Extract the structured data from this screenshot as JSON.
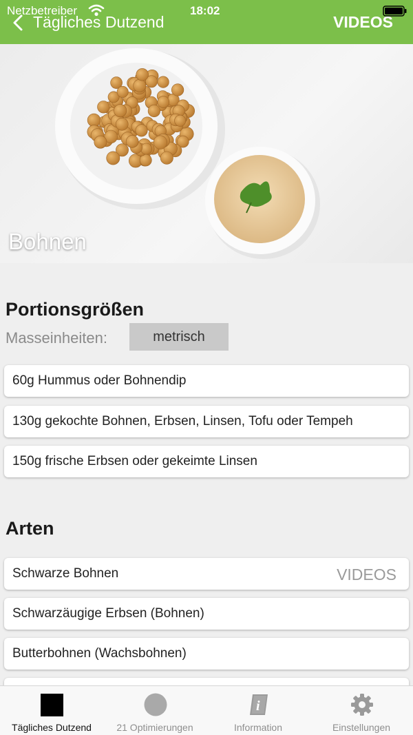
{
  "status_bar": {
    "carrier": "Netzbetreiber",
    "time": "18:02"
  },
  "nav": {
    "back_label": "Tägliches Dutzend",
    "videos_label": "VIDEOS"
  },
  "hero": {
    "title": "Bohnen"
  },
  "portions": {
    "title": "Portionsgrößen",
    "units_label": "Masseinheiten:",
    "units_value": "metrisch",
    "items": [
      "60g Hummus oder Bohnendip",
      "130g gekochte Bohnen, Erbsen, Linsen, Tofu oder Tempeh",
      "150g frische Erbsen oder gekeimte Linsen"
    ]
  },
  "types": {
    "title": "Arten",
    "items": [
      {
        "label": "Schwarze Bohnen",
        "videos": "VIDEOS"
      },
      {
        "label": "Schwarzäugige Erbsen (Bohnen)"
      },
      {
        "label": "Butterbohnen (Wachsbohnen)"
      }
    ]
  },
  "tabbar": {
    "tabs": [
      {
        "label": "Tägliches Dutzend",
        "icon": "square-icon"
      },
      {
        "label": "21 Optimierungen",
        "icon": "circle-icon"
      },
      {
        "label": "Information",
        "icon": "info-book-icon"
      },
      {
        "label": "Einstellungen",
        "icon": "gear-icon"
      }
    ]
  },
  "colors": {
    "header": "#7cbf4a",
    "tab_active": "#111111",
    "tab_inactive": "#8e8e8e"
  }
}
